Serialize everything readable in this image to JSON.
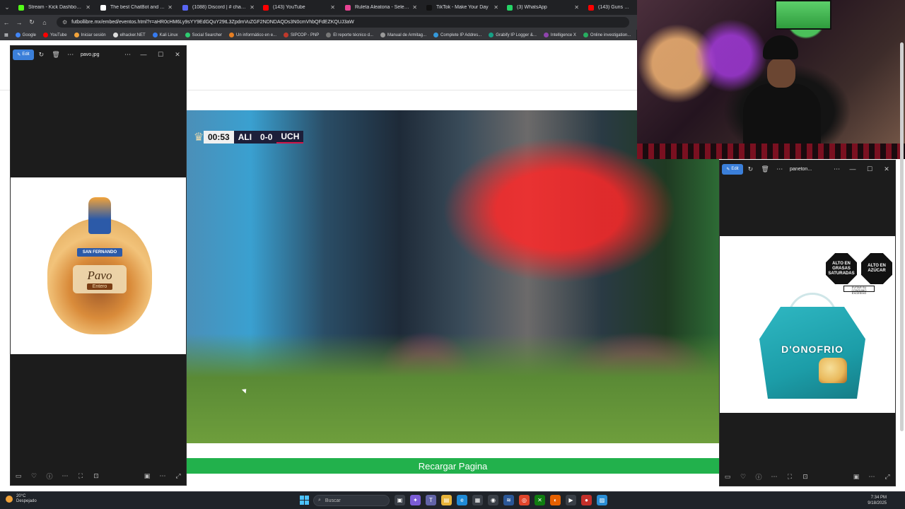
{
  "browser": {
    "tabs": [
      {
        "label": "Stream - Kick Dashboard",
        "color": "#53fc18"
      },
      {
        "label": "The best ChatBot and Widget",
        "color": "#ffffff"
      },
      {
        "label": "(1088) Discord | # chat-gen",
        "color": "#5865f2"
      },
      {
        "label": "(143) YouTube",
        "color": "#ff0000"
      },
      {
        "label": "Ruleta Aleatoria - Selector Po",
        "color": "#e84393"
      },
      {
        "label": "TikTok - Make Your Day",
        "color": "#111111"
      },
      {
        "label": "(3) WhatsApp",
        "color": "#25d366"
      },
      {
        "label": "(143) Guns N' Roses -",
        "color": "#ff0000"
      }
    ],
    "url": "futbollibre.mx/embed/eventos.html?r=aHR0cHM6Ly9sYY9EdGQuY29tL3ZpdmVuZGF2NDNDAQDs3N0cmVhbQFdEZKQUJ3aW",
    "bookmarks": [
      {
        "label": "Google",
        "color": "#4285f4"
      },
      {
        "label": "YouTube",
        "color": "#ff0000"
      },
      {
        "label": "Iniciar sesión",
        "color": "#f2a33a"
      },
      {
        "label": "elhacker.NET",
        "color": "#dddddd"
      },
      {
        "label": "Kali Linux",
        "color": "#367bf0"
      },
      {
        "label": "Social Searcher",
        "color": "#2ecc71"
      },
      {
        "label": "Un informático en e...",
        "color": "#e67e22"
      },
      {
        "label": "SIPCOP - PNP",
        "color": "#c0392b"
      },
      {
        "label": "El reporte técnico d...",
        "color": "#777777"
      },
      {
        "label": "Manual de Armitag...",
        "color": "#999999"
      },
      {
        "label": "Complete IP Addres...",
        "color": "#3498db"
      },
      {
        "label": "Grabify IP Logger &...",
        "color": "#16a085"
      },
      {
        "label": "Intelligence X",
        "color": "#8e44ad"
      },
      {
        "label": "Online investigation...",
        "color": "#27ae60"
      }
    ]
  },
  "video": {
    "score": {
      "time": "00:53",
      "home": "ALI",
      "result": "0-0",
      "away": "UCH"
    }
  },
  "page": {
    "reload_label": "Recargar Pagina"
  },
  "viewer_left": {
    "edit_label": "Edit",
    "filename": "pavo.jpg",
    "product": {
      "brand": "SAN FERNANDO",
      "name": "Pavo",
      "variant": "Entero"
    }
  },
  "viewer_right": {
    "edit_label": "Edit",
    "filename": "paneton...",
    "badges": [
      "ALTO EN GRASAS SATURADAS",
      "ALTO EN AZÚCAR"
    ],
    "badge_note": "EVITAR SU CONSUMO EXCESIVO",
    "brand": "D'ONOFRIO"
  },
  "taskbar": {
    "temperature": "20°C",
    "weather": "Despejado",
    "search_placeholder": "Buscar",
    "time": "7:34 PM",
    "date": "9/18/2025"
  },
  "colors": {
    "reload_green": "#22b14c",
    "edit_blue": "#3b7fd9",
    "away_red": "#d0174a"
  }
}
